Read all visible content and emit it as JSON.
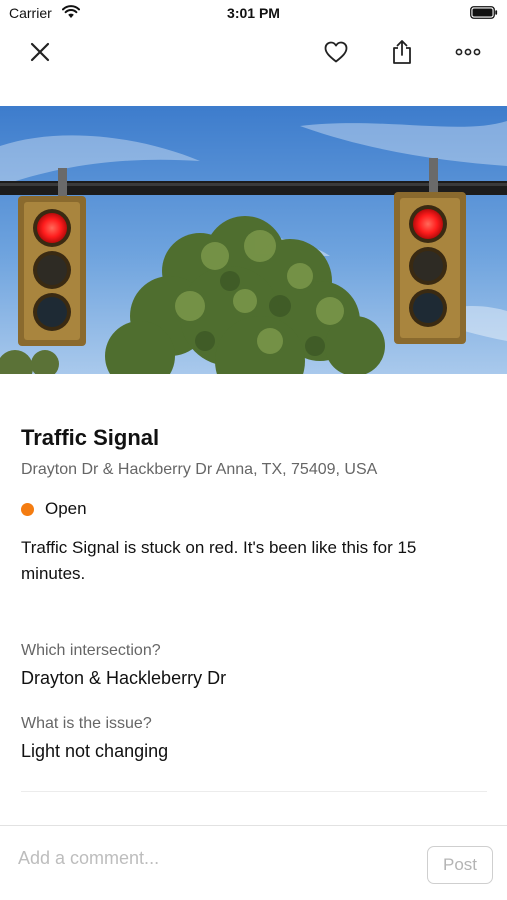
{
  "status_bar": {
    "carrier": "Carrier",
    "time": "3:01 PM",
    "wifi_icon": "wifi-icon",
    "battery_icon": "battery-icon"
  },
  "nav": {
    "close_icon": "close-icon",
    "favorite_icon": "heart-icon",
    "share_icon": "share-icon",
    "more_icon": "more-icon"
  },
  "report": {
    "title": "Traffic Signal",
    "address": "Drayton Dr & Hackberry Dr Anna, TX, 75409, USA",
    "status_label": "Open",
    "status_color": "#F47C11",
    "description": "Traffic Signal is stuck on red. It's been like this for 15 minutes."
  },
  "fields": [
    {
      "label": "Which intersection?",
      "value": "Drayton & Hackleberry Dr"
    },
    {
      "label": "What is the issue?",
      "value": "Light not changing"
    }
  ],
  "comment": {
    "placeholder": "Add a comment...",
    "post_label": "Post"
  },
  "colors": {
    "accent_status": "#F47C11",
    "secondary_text": "#666666",
    "placeholder_text": "#bdbdbd"
  }
}
